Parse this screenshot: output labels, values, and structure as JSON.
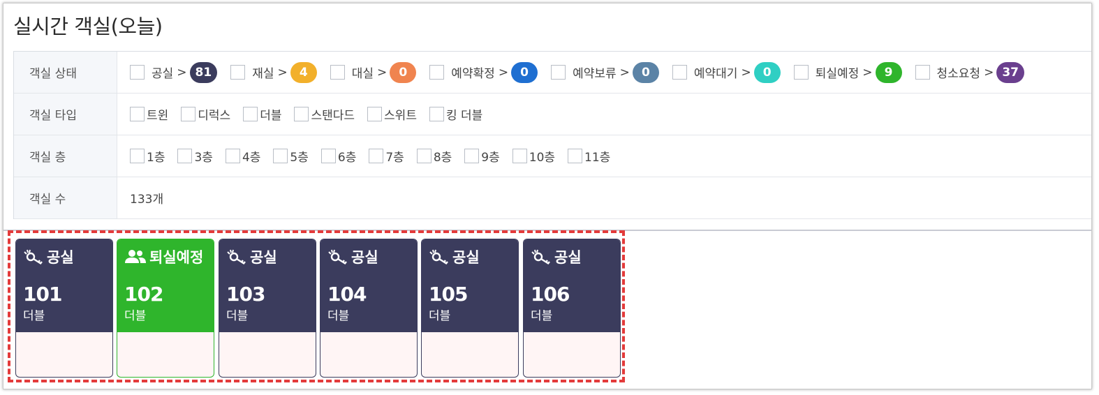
{
  "page": {
    "title": "실시간 객실(오늘)"
  },
  "filters": {
    "status": {
      "label": "객실 상태",
      "items": [
        {
          "label": "공실",
          "count": "81",
          "color": "#3b3c5d"
        },
        {
          "label": "재실",
          "count": "4",
          "color": "#f2b02b"
        },
        {
          "label": "대실",
          "count": "0",
          "color": "#f0844f"
        },
        {
          "label": "예약확정",
          "count": "0",
          "color": "#1f6fd1"
        },
        {
          "label": "예약보류",
          "count": "0",
          "color": "#5b83a6"
        },
        {
          "label": "예약대기",
          "count": "0",
          "color": "#2fcfc3"
        },
        {
          "label": "퇴실예정",
          "count": "9",
          "color": "#2fb52c"
        },
        {
          "label": "청소요청",
          "count": "37",
          "color": "#6a3f8e"
        }
      ]
    },
    "type": {
      "label": "객실 타입",
      "items": [
        "트윈",
        "디럭스",
        "더블",
        "스탠다드",
        "스위트",
        "킹 더블"
      ]
    },
    "floor": {
      "label": "객실 층",
      "items": [
        "1층",
        "3층",
        "4층",
        "5층",
        "6층",
        "7층",
        "8층",
        "9층",
        "10층",
        "11층"
      ]
    },
    "count": {
      "label": "객실 수",
      "value": "133개"
    }
  },
  "rooms": [
    {
      "status": "공실",
      "number": "101",
      "type": "더블",
      "color": "#3b3c5d",
      "icon": "key-icon"
    },
    {
      "status": "퇴실예정",
      "number": "102",
      "type": "더블",
      "color": "#2fb52c",
      "icon": "users-icon"
    },
    {
      "status": "공실",
      "number": "103",
      "type": "더블",
      "color": "#3b3c5d",
      "icon": "key-icon"
    },
    {
      "status": "공실",
      "number": "104",
      "type": "더블",
      "color": "#3b3c5d",
      "icon": "key-icon"
    },
    {
      "status": "공실",
      "number": "105",
      "type": "더블",
      "color": "#3b3c5d",
      "icon": "key-icon"
    },
    {
      "status": "공실",
      "number": "106",
      "type": "더블",
      "color": "#3b3c5d",
      "icon": "key-icon"
    }
  ]
}
